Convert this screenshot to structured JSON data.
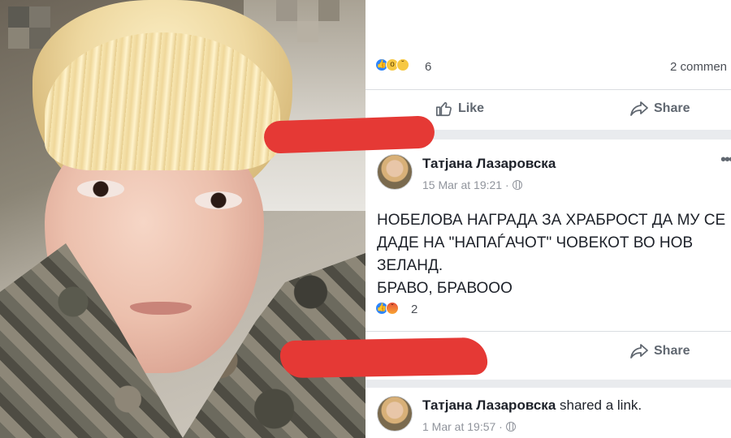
{
  "post_top": {
    "reaction_icons": [
      "like-reaction",
      "wow-reaction",
      "sad-reaction"
    ],
    "reaction_count": "6",
    "comments": "2 commen",
    "like_label": "Like",
    "share_label": "Share"
  },
  "post_main": {
    "author": "Татјана Лазаровска",
    "timestamp": "15 Mar at 19:21 ·",
    "text_lines": [
      "НОБЕЛОВА НАГРАДА ЗА ХРАБРОСТ ДА МУ СЕ",
      "ДАДЕ НА \"НАПАЃАЧОТ\" ЧОВЕКОТ  ВО НОВ",
      "ЗЕЛАНД.",
      "БРАВО, БРАВООО"
    ],
    "reaction_icons": [
      "like-reaction",
      "angry-reaction"
    ],
    "reaction_count": "2",
    "share_label": "Share"
  },
  "post_bottom": {
    "author": "Татјана Лазаровска",
    "shared_text": " shared a link.",
    "timestamp": "1 Mar at 19:57 ·"
  },
  "colors": {
    "redaction": "#e53935",
    "like_blue": "#2d86ff",
    "feed_bg": "#e9ebee"
  }
}
